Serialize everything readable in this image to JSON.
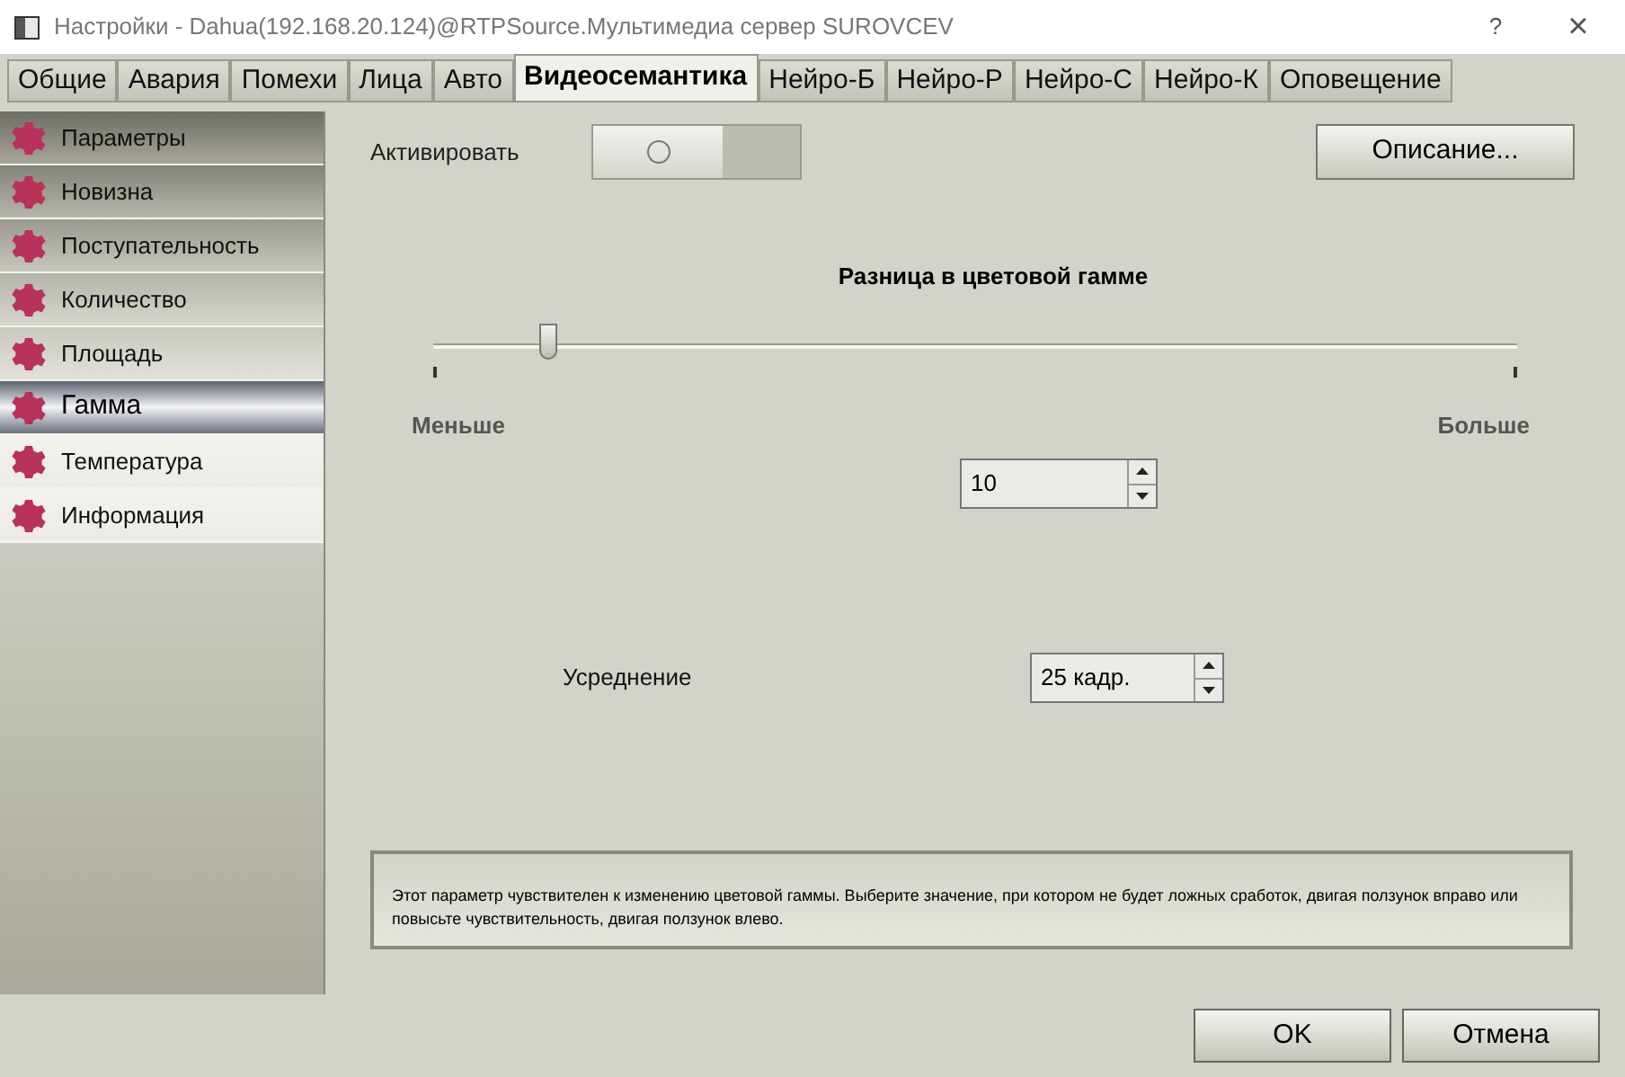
{
  "window": {
    "title": "Настройки - Dahua(192.168.20.124)@RTPSource.Мультимедиа сервер SUROVCEV",
    "help": "?",
    "close": "×"
  },
  "tabs": [
    {
      "label": "Общие",
      "selected": false
    },
    {
      "label": "Авария",
      "selected": false
    },
    {
      "label": "Помехи",
      "selected": false
    },
    {
      "label": "Лица",
      "selected": false
    },
    {
      "label": "Авто",
      "selected": false
    },
    {
      "label": "Видеосемантика",
      "selected": true
    },
    {
      "label": "Нейро-Б",
      "selected": false
    },
    {
      "label": "Нейро-Р",
      "selected": false
    },
    {
      "label": "Нейро-С",
      "selected": false
    },
    {
      "label": "Нейро-К",
      "selected": false
    },
    {
      "label": "Оповещение",
      "selected": false
    }
  ],
  "sidebar": {
    "items": [
      {
        "label": "Параметры",
        "selected": false
      },
      {
        "label": "Новизна",
        "selected": false
      },
      {
        "label": "Поступательность",
        "selected": false
      },
      {
        "label": "Количество",
        "selected": false
      },
      {
        "label": "Площадь",
        "selected": false
      },
      {
        "label": "Гамма",
        "selected": true
      },
      {
        "label": "Температура",
        "selected": false
      },
      {
        "label": "Информация",
        "selected": false
      }
    ]
  },
  "activate": {
    "label": "Активировать",
    "on": false
  },
  "description_button": "Описание...",
  "slider": {
    "title": "Разница в цветовой гамме",
    "level": 0.106,
    "min_label": "Меньше",
    "max_label": "Больше"
  },
  "value_spin": {
    "value": "10"
  },
  "averaging": {
    "label": "Усреднение",
    "value": "25 кадр."
  },
  "hint": "Этот параметр чувствителен к изменению цветовой гаммы. Выберите значение, при котором не будет ложных сработок, двигая ползунок вправо или повысьте чувствительность, двигая ползунок влево.",
  "buttons": [
    "OK",
    "Отмена"
  ]
}
